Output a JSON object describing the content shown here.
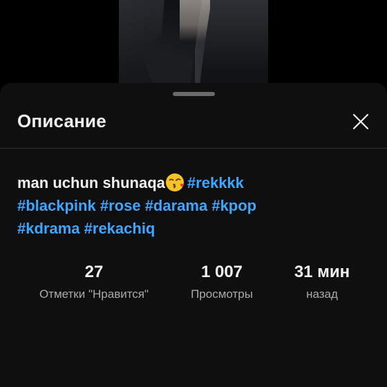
{
  "sheet": {
    "title": "Описание",
    "close_icon": "close-icon"
  },
  "description": {
    "text": "man uchun shunaqa",
    "emoji": "😘",
    "hashtags": [
      "#rekkkk",
      "#blackpink",
      "#rose",
      "#darama",
      "#kpop",
      "#kdrama",
      "#rekachiq"
    ]
  },
  "stats": {
    "likes": {
      "value": "27",
      "label": "Отметки \"Нравится\""
    },
    "views": {
      "value": "1 007",
      "label": "Просмотры"
    },
    "time": {
      "value": "31 мин",
      "label": "назад"
    }
  },
  "colors": {
    "background": "#0f0f0f",
    "text": "#f1f1f1",
    "secondary_text": "#aaaaaa",
    "hashtag": "#3ea6ff",
    "handle": "#6a6a6a"
  }
}
